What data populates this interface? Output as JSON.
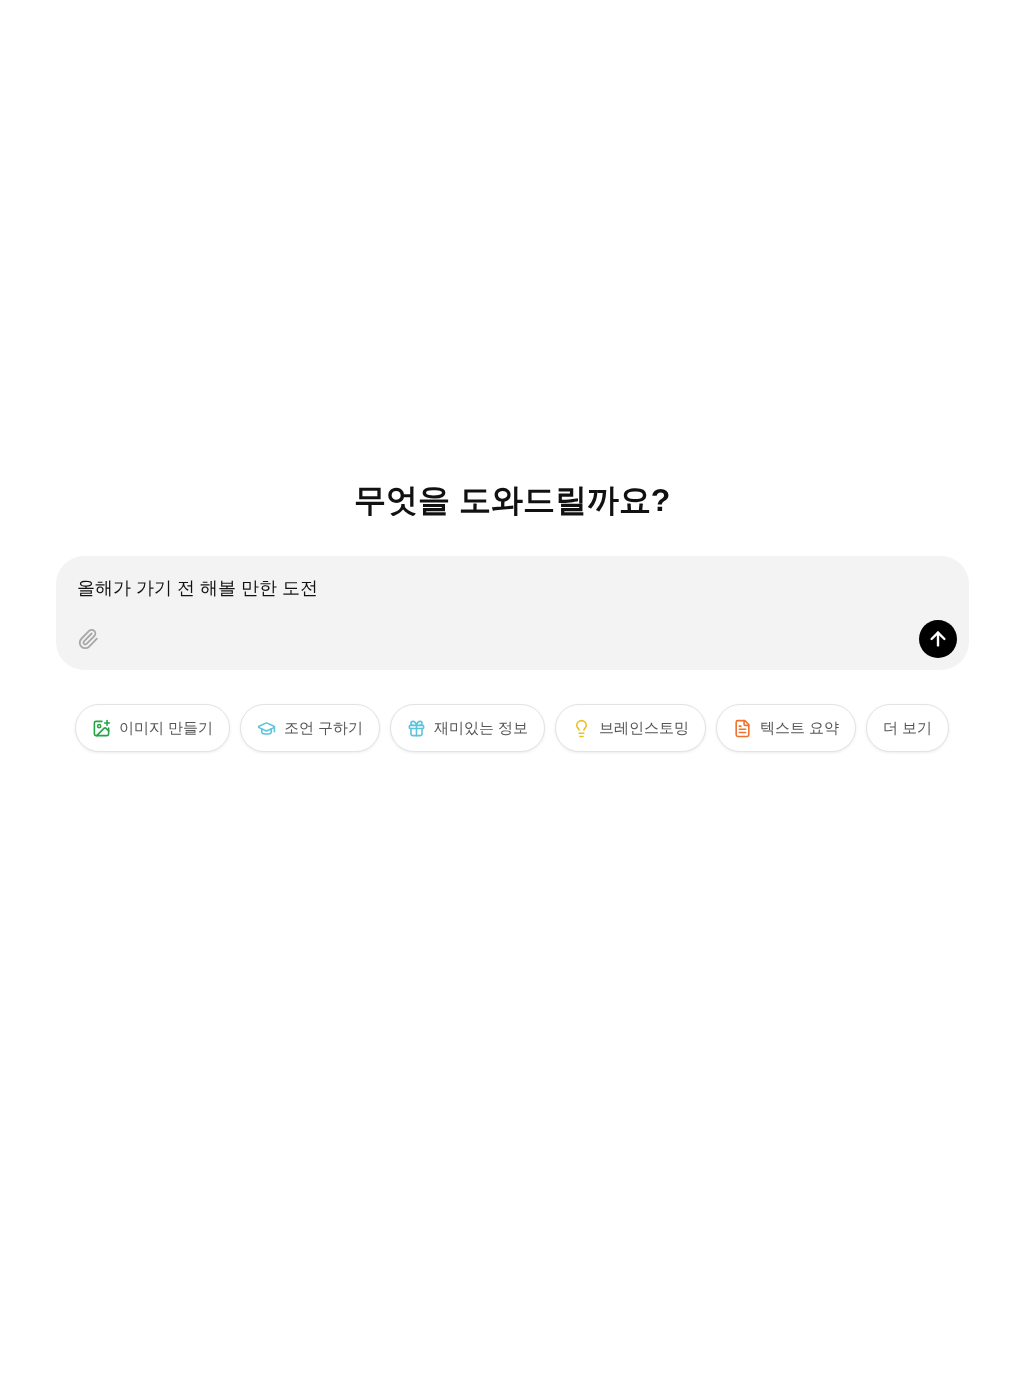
{
  "heading": "무엇을 도와드릴까요?",
  "composer": {
    "value": "올해가 가기 전 해볼 만한 도전"
  },
  "suggestions": [
    {
      "label": "이미지 만들기",
      "kind": "image",
      "color": "#22a447"
    },
    {
      "label": "조언 구하기",
      "kind": "advice",
      "color": "#5ec3dc"
    },
    {
      "label": "재미있는 정보",
      "kind": "fun",
      "color": "#5ec3dc"
    },
    {
      "label": "브레인스토밍",
      "kind": "idea",
      "color": "#e6c21f"
    },
    {
      "label": "텍스트 요약",
      "kind": "summary",
      "color": "#f0702c"
    },
    {
      "label": "더 보기",
      "kind": "more"
    }
  ]
}
